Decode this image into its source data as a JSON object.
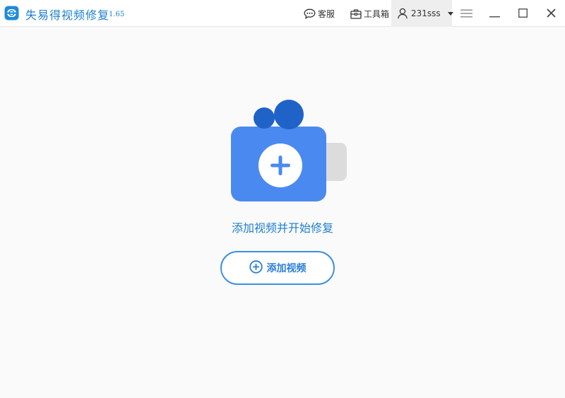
{
  "app": {
    "name": "失易得视频修复",
    "version": "1.65"
  },
  "titlebar": {
    "service_label": "客服",
    "toolbox_label": "工具箱",
    "username": "231sss"
  },
  "main": {
    "headline": "添加视频并开始修复",
    "add_button_label": "添加视频"
  },
  "icons": {
    "logo": "app-logo-icon",
    "service": "chat-bubble-icon",
    "toolbox": "toolbox-icon",
    "user": "user-icon",
    "caret": "caret-down-icon",
    "menu": "hamburger-menu-icon",
    "minimize": "minimize-icon",
    "maximize": "maximize-icon",
    "close": "close-icon",
    "plus": "plus-circle-icon"
  },
  "colors": {
    "brand_blue": "#1f7fcf",
    "camera_body": "#4a8af0",
    "camera_reels": "#1f62c8",
    "camera_lens": "#dcdcdc",
    "button_border": "#3d8fe0"
  }
}
